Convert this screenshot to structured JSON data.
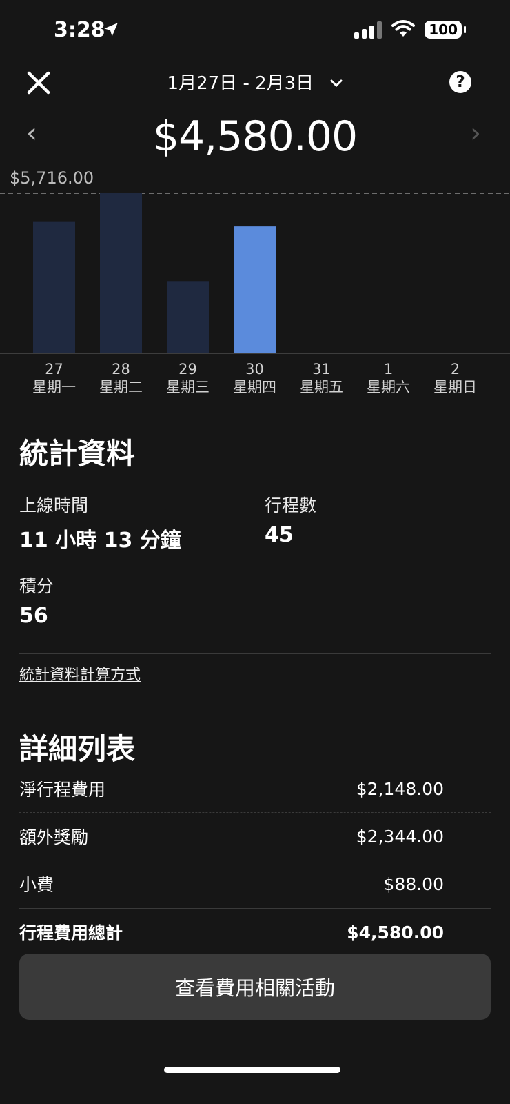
{
  "status": {
    "time": "3:28",
    "battery": "100"
  },
  "header": {
    "date_range": "1月27日 - 2月3日",
    "help": "?"
  },
  "summary": {
    "total": "$4,580.00",
    "prev": "‹",
    "next": "›"
  },
  "chart_data": {
    "type": "bar",
    "max_label": "$5,716.00",
    "ylim": [
      0,
      5716
    ],
    "categories": [
      "星期一",
      "星期二",
      "星期三",
      "星期四",
      "星期五",
      "星期六",
      "星期日"
    ],
    "dates": [
      "27",
      "28",
      "29",
      "30",
      "31",
      "1",
      "2"
    ],
    "values": [
      4690,
      5716,
      2580,
      4530,
      0,
      0,
      0
    ],
    "selected_index": 3,
    "colors": {
      "bar": "#1f2940",
      "selected": "#5b8bdc"
    }
  },
  "stats": {
    "title": "統計資料",
    "online_label": "上線時間",
    "online_value": "11 小時 13 分鐘",
    "trips_label": "行程數",
    "trips_value": "45",
    "points_label": "積分",
    "points_value": "56",
    "how_link": "統計資料計算方式"
  },
  "breakdown": {
    "title": "詳細列表",
    "rows": [
      {
        "label": "淨行程費用",
        "value": "$2,148.00"
      },
      {
        "label": "額外獎勵",
        "value": "$2,344.00"
      },
      {
        "label": "小費",
        "value": "$88.00"
      }
    ],
    "total_label": "行程費用總計",
    "total_value": "$4,580.00"
  },
  "cta": {
    "label": "查看費用相關活動"
  }
}
